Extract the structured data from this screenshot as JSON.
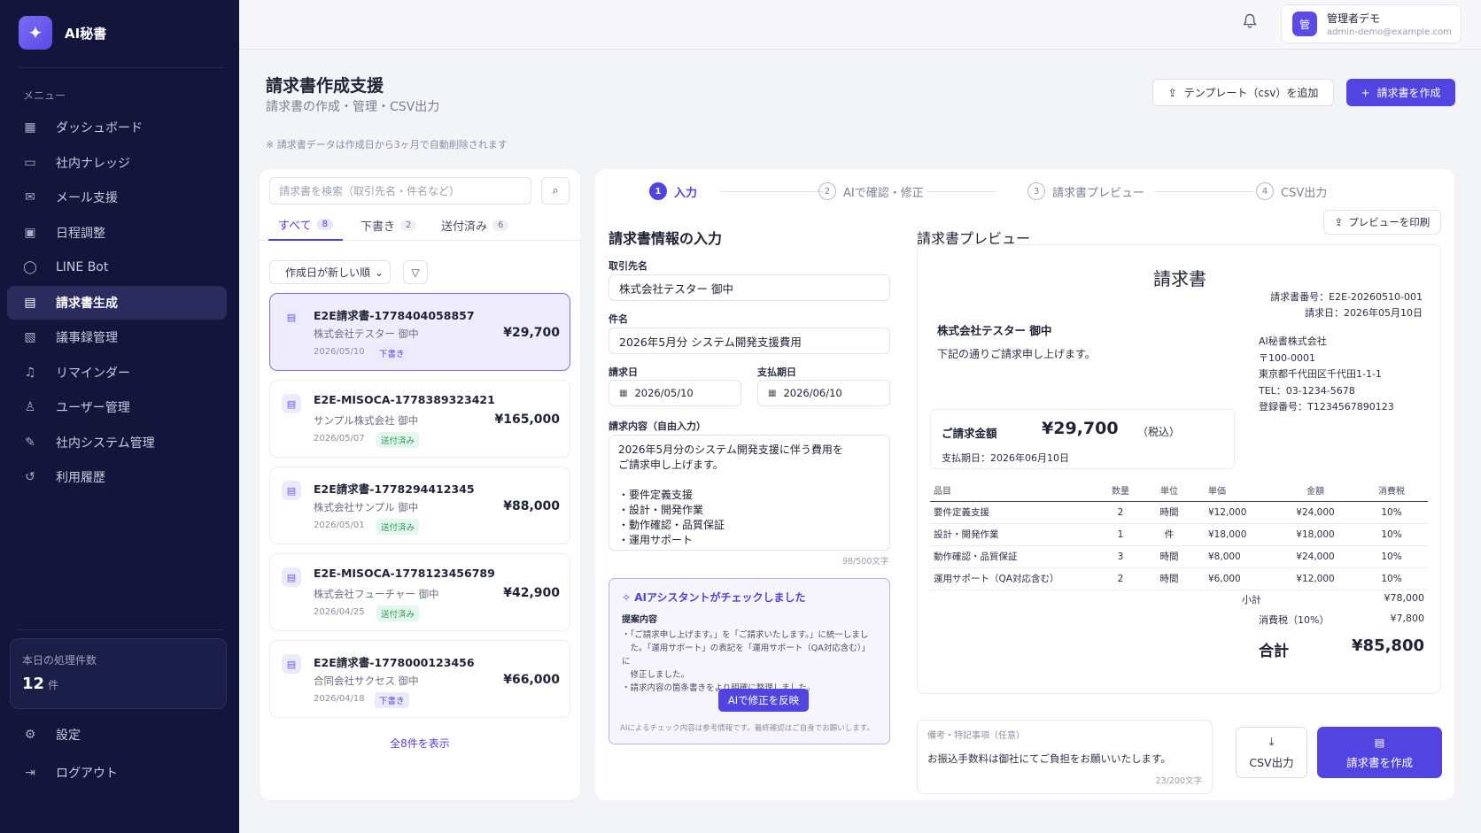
{
  "app": {
    "name": "AI秘書",
    "logo_icon": "✦"
  },
  "sidebar": {
    "menu_label": "メニュー",
    "items": [
      {
        "label": "ダッシュボード",
        "icon": "▦"
      },
      {
        "label": "社内ナレッジ",
        "icon": "▭"
      },
      {
        "label": "メール支援",
        "icon": "✉"
      },
      {
        "label": "日程調整",
        "icon": "▣"
      },
      {
        "label": "LINE Bot",
        "icon": "◯"
      },
      {
        "label": "請求書生成",
        "icon": "▤"
      },
      {
        "label": "議事録管理",
        "icon": "▧"
      },
      {
        "label": "リマインダー",
        "icon": "♫"
      },
      {
        "label": "ユーザー管理",
        "icon": "♙"
      },
      {
        "label": "社内システム管理",
        "icon": "✎"
      },
      {
        "label": "利用履歴",
        "icon": "↺"
      }
    ],
    "active_item": "請求書生成",
    "today": {
      "label": "本日の処理件数",
      "count": "12",
      "unit": "件"
    },
    "settings": {
      "label": "設定",
      "icon": "⚙"
    },
    "logout": {
      "label": "ログアウト",
      "icon": "⇥"
    }
  },
  "topbar": {
    "bell_icon": "🔔",
    "user": {
      "avatar": "管",
      "name": "管理者デモ",
      "email": "admin-demo@example.com"
    }
  },
  "page": {
    "title": "請求書作成支援",
    "subtitle": "請求書の作成・管理・CSV出力",
    "notice": "※ 請求書データは作成日から3ヶ月で自動削除されます",
    "template_button": "テンプレート（csv）を追加",
    "template_icon": "⇪",
    "create_button": "請求書を作成",
    "create_icon": "+"
  },
  "list": {
    "search_placeholder": "請求書を検索（取引先名・件名など）",
    "search_icon": "⌕",
    "tabs": [
      {
        "label": "すべて",
        "count": "8"
      },
      {
        "label": "下書き",
        "count": "2"
      },
      {
        "label": "送付済み",
        "count": "6"
      }
    ],
    "sort_label": "作成日が新しい順",
    "sort_chevron": "⌄",
    "filter_icon": "▽",
    "doc_icon": "▤",
    "invoices": [
      {
        "number": "E2E請求書-1778404058857",
        "client": "株式会社テスター 御中",
        "date": "2026/05/10",
        "status": "下書き",
        "amount": "¥29,700"
      },
      {
        "number": "E2E-MISOCA-1778389323421",
        "client": "サンプル株式会社 御中",
        "date": "2026/05/07",
        "status": "送付済み",
        "amount": "¥165,000"
      },
      {
        "number": "E2E請求書-1778294412345",
        "client": "株式会社サンプル 御中",
        "date": "2026/05/01",
        "status": "送付済み",
        "amount": "¥88,000"
      },
      {
        "number": "E2E-MISOCA-1778123456789",
        "client": "株式会社フューチャー 御中",
        "date": "2026/04/25",
        "status": "送付済み",
        "amount": "¥42,900"
      },
      {
        "number": "E2E請求書-1778000123456",
        "client": "合同会社サクセス 御中",
        "date": "2026/04/18",
        "status": "下書き",
        "amount": "¥66,000"
      }
    ],
    "show_all": "全8件を表示"
  },
  "steps": [
    {
      "num": "1",
      "label": "入力"
    },
    {
      "num": "2",
      "label": "AIで確認・修正"
    },
    {
      "num": "3",
      "label": "請求書プレビュー"
    },
    {
      "num": "4",
      "label": "CSV出力"
    }
  ],
  "form": {
    "title": "請求書情報の入力",
    "client_label": "取引先名",
    "client_value": "株式会社テスター 御中",
    "subject_label": "件名",
    "subject_value": "2026年5月分 システム開発支援費用",
    "issue_date_label": "請求日",
    "issue_date_value": "2026/05/10",
    "due_date_label": "支払期日",
    "due_date_value": "2026/06/10",
    "calendar_icon": "▦",
    "content_label": "請求内容（自由入力）",
    "content_lines": [
      "2026年5月分のシステム開発支援に伴う費用を",
      "ご請求申し上げます。",
      "",
      "・要件定義支援",
      "・設計・開発作業",
      "・動作確認・品質保証",
      "・運用サポート"
    ],
    "content_count": "98/500文字"
  },
  "ai": {
    "icon": "✧",
    "title": "AIアシスタントがチェックしました",
    "subtitle": "提案内容",
    "items": [
      "・「ご請求申し上げます。」を「ご請求いたします。」に統一しまし",
      "　た。「運用サポート」の表記を「運用サポート（QA対応含む）」に",
      "　修正しました。",
      "・請求内容の箇条書きをより明確に整理しました。"
    ],
    "apply_button": "AIで修正を反映",
    "note": "AIによるチェック内容は参考情報です。最終確認はご自身でお願いします。"
  },
  "preview": {
    "section_title": "請求書プレビュー",
    "print_button": "プレビューを印刷",
    "print_icon": "⇪",
    "doc_title": "請求書",
    "invoice_no": "請求書番号：E2E-20260510-001",
    "issue_date": "請求日：2026年05月10日",
    "client": "株式会社テスター 御中",
    "message": "下記の通りご請求申し上げます。",
    "issuer": [
      "AI秘書株式会社",
      "〒100-0001",
      "東京都千代田区千代田1-1-1",
      "TEL：03-1234-5678",
      "登録番号：T1234567890123"
    ],
    "amount_label": "ご請求金額",
    "amount_value": "¥29,700",
    "amount_tax": "（税込）",
    "due": "支払期日：2026年06月10日",
    "columns": [
      "品目",
      "数量",
      "単位",
      "単価",
      "金額",
      "消費税"
    ],
    "rows": [
      [
        "要件定義支援",
        "2",
        "時間",
        "¥12,000",
        "¥24,000",
        "10%"
      ],
      [
        "設計・開発作業",
        "1",
        "件",
        "¥18,000",
        "¥18,000",
        "10%"
      ],
      [
        "動作確認・品質保証",
        "3",
        "時間",
        "¥8,000",
        "¥24,000",
        "10%"
      ],
      [
        "運用サポート（QA対応含む）",
        "2",
        "時間",
        "¥6,000",
        "¥12,000",
        "10%"
      ]
    ],
    "subtotal_label": "小計",
    "subtotal_value": "¥78,000",
    "tax_label": "消費税（10%）",
    "tax_value": "¥7,800",
    "total_label": "合計",
    "total_value": "¥85,800"
  },
  "remarks": {
    "label": "備考・特記事項（任意）",
    "text": "お振込手数料は御社にてご負担をお願いいたします。",
    "count": "23/200文字"
  },
  "actions": {
    "csv_label": "CSV出力",
    "csv_icon": "⤓",
    "make_label": "請求書を作成",
    "make_icon": "▤"
  }
}
